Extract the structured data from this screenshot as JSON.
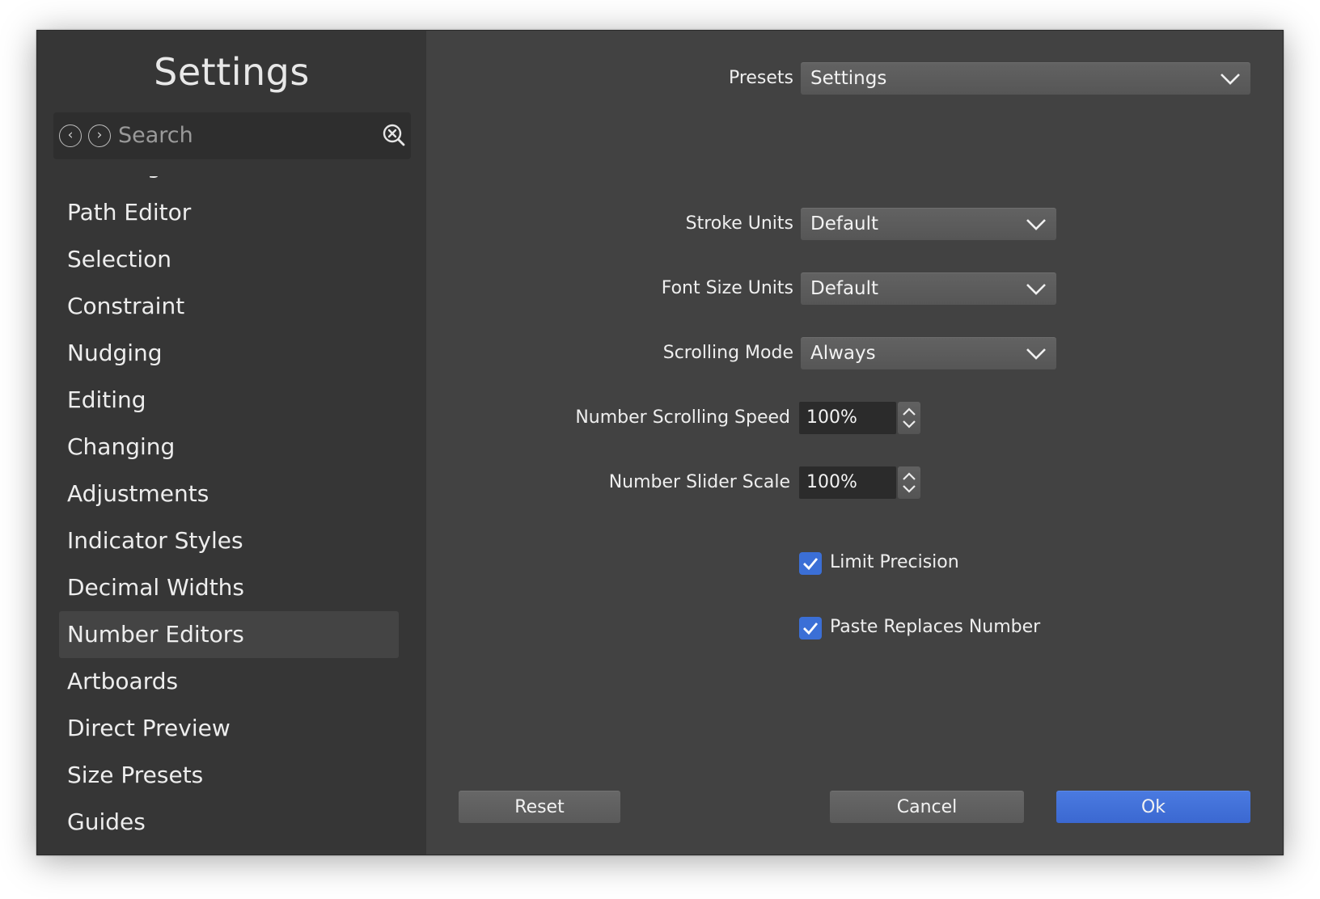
{
  "sidebar": {
    "title": "Settings",
    "search": {
      "placeholder": "Search"
    },
    "items": [
      {
        "label": "Drawing"
      },
      {
        "label": "Path Editor"
      },
      {
        "label": "Selection"
      },
      {
        "label": "Constraint"
      },
      {
        "label": "Nudging"
      },
      {
        "label": "Editing"
      },
      {
        "label": "Changing"
      },
      {
        "label": "Adjustments"
      },
      {
        "label": "Indicator Styles"
      },
      {
        "label": "Decimal Widths"
      },
      {
        "label": "Number Editors"
      },
      {
        "label": "Artboards"
      },
      {
        "label": "Direct Preview"
      },
      {
        "label": "Size Presets"
      },
      {
        "label": "Guides"
      }
    ],
    "selected": "Number Editors"
  },
  "content": {
    "presets": {
      "label": "Presets",
      "value": "Settings"
    },
    "stroke_units": {
      "label": "Stroke Units",
      "value": "Default"
    },
    "font_size_units": {
      "label": "Font Size Units",
      "value": "Default"
    },
    "scrolling_mode": {
      "label": "Scrolling Mode",
      "value": "Always"
    },
    "number_scrolling_speed": {
      "label": "Number Scrolling Speed",
      "value": "100%"
    },
    "number_slider_scale": {
      "label": "Number Slider Scale",
      "value": "100%"
    },
    "limit_precision": {
      "label": "Limit Precision",
      "checked": true
    },
    "paste_replaces_number": {
      "label": "Paste Replaces Number",
      "checked": true
    }
  },
  "buttons": {
    "reset": "Reset",
    "cancel": "Cancel",
    "ok": "Ok"
  },
  "colors": {
    "accent": "#3b6fd6",
    "window_bg": "#424242",
    "sidebar_bg": "#363636"
  }
}
